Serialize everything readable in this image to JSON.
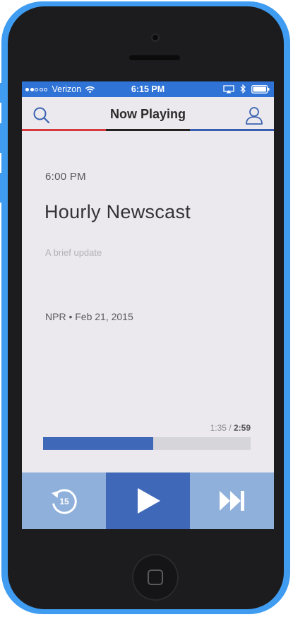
{
  "status_bar": {
    "carrier": "Verizon",
    "time": "6:15 PM",
    "signal_bars_filled": 2,
    "signal_bars_total": 5
  },
  "nav": {
    "title": "Now Playing",
    "stripe_colors": [
      "#d63a3f",
      "#222222",
      "#3a5fb0"
    ]
  },
  "episode": {
    "air_time": "6:00 PM",
    "title": "Hourly Newscast",
    "description": "A brief update",
    "meta": "NPR • Feb 21, 2015"
  },
  "player": {
    "elapsed": "1:35",
    "separator": " / ",
    "duration": "2:59",
    "progress_fraction": 0.53,
    "skip_back_seconds": "15"
  },
  "colors": {
    "status_bar": "#2f73d6",
    "accent": "#4068b8",
    "control_light": "#8fb0db",
    "control_dark": "#4068b8",
    "phone_body": "#3f9cf0"
  },
  "icons": {
    "search": "search-icon",
    "account": "account-icon",
    "rewind": "rewind-15-icon",
    "play": "play-icon",
    "fast_forward": "fast-forward-icon"
  }
}
